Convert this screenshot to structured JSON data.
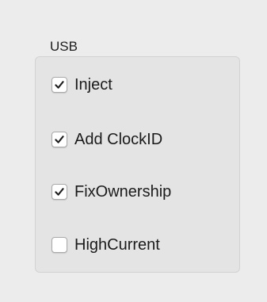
{
  "group": {
    "title": "USB"
  },
  "options": [
    {
      "label": "Inject",
      "checked": true
    },
    {
      "label": "Add ClockID",
      "checked": true
    },
    {
      "label": "FixOwnership",
      "checked": true
    },
    {
      "label": "HighCurrent",
      "checked": false
    }
  ],
  "icons": {
    "checked": "checkmark-icon"
  }
}
